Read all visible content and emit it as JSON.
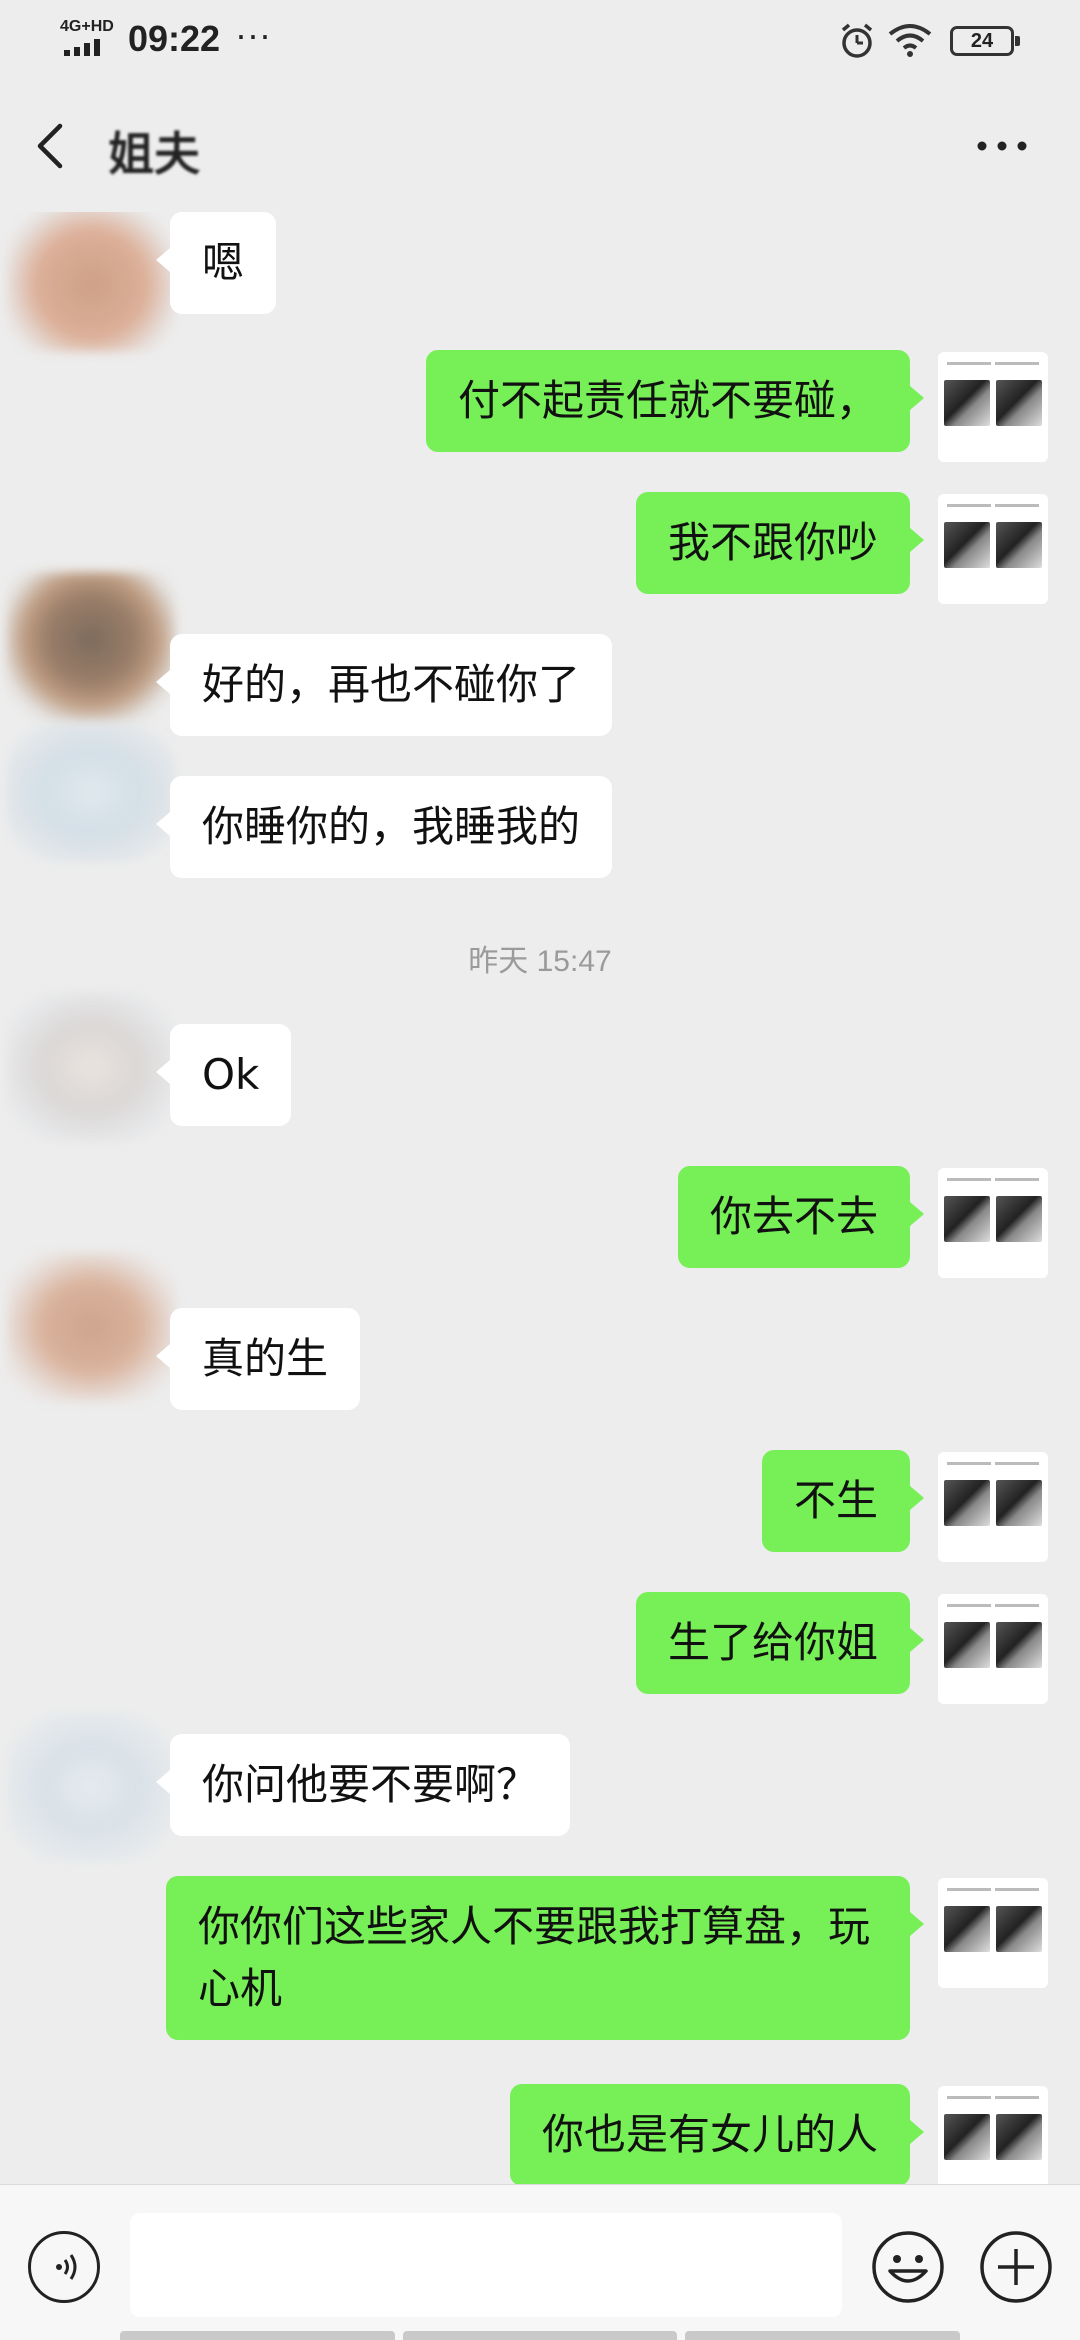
{
  "status_bar": {
    "network": "4G+HD",
    "time": "09:22",
    "more": "···",
    "battery": "24"
  },
  "header": {
    "title": "姐夫"
  },
  "messages": [
    {
      "side": "left",
      "text": "嗯"
    },
    {
      "side": "right",
      "text": "付不起责任就不要碰，"
    },
    {
      "side": "right",
      "text": "我不跟你吵"
    },
    {
      "side": "left",
      "text": "好的，再也不碰你了"
    },
    {
      "side": "left",
      "text": "你睡你的，我睡我的"
    },
    {
      "type": "timestamp",
      "text": "昨天 15:47"
    },
    {
      "side": "left",
      "text": "Ok"
    },
    {
      "side": "right",
      "text": "你去不去"
    },
    {
      "side": "left",
      "text": "真的生"
    },
    {
      "side": "right",
      "text": "不生"
    },
    {
      "side": "right",
      "text": "生了给你姐"
    },
    {
      "side": "left",
      "text": "你问他要不要啊？"
    },
    {
      "side": "right",
      "text": "你你们这些家人不要跟我打算盘，玩心机"
    },
    {
      "side": "right",
      "text": "你也是有女儿的人"
    }
  ],
  "input_bar": {
    "placeholder": ""
  },
  "colors": {
    "background": "#ededed",
    "outgoing_bubble": "#77ef57",
    "incoming_bubble": "#ffffff",
    "timestamp_text": "#9a9a9a"
  },
  "icons": [
    "back-arrow-icon",
    "more-dots-icon",
    "alarm-icon",
    "wifi-icon",
    "battery-icon",
    "voice-icon",
    "emoji-icon",
    "plus-icon"
  ]
}
